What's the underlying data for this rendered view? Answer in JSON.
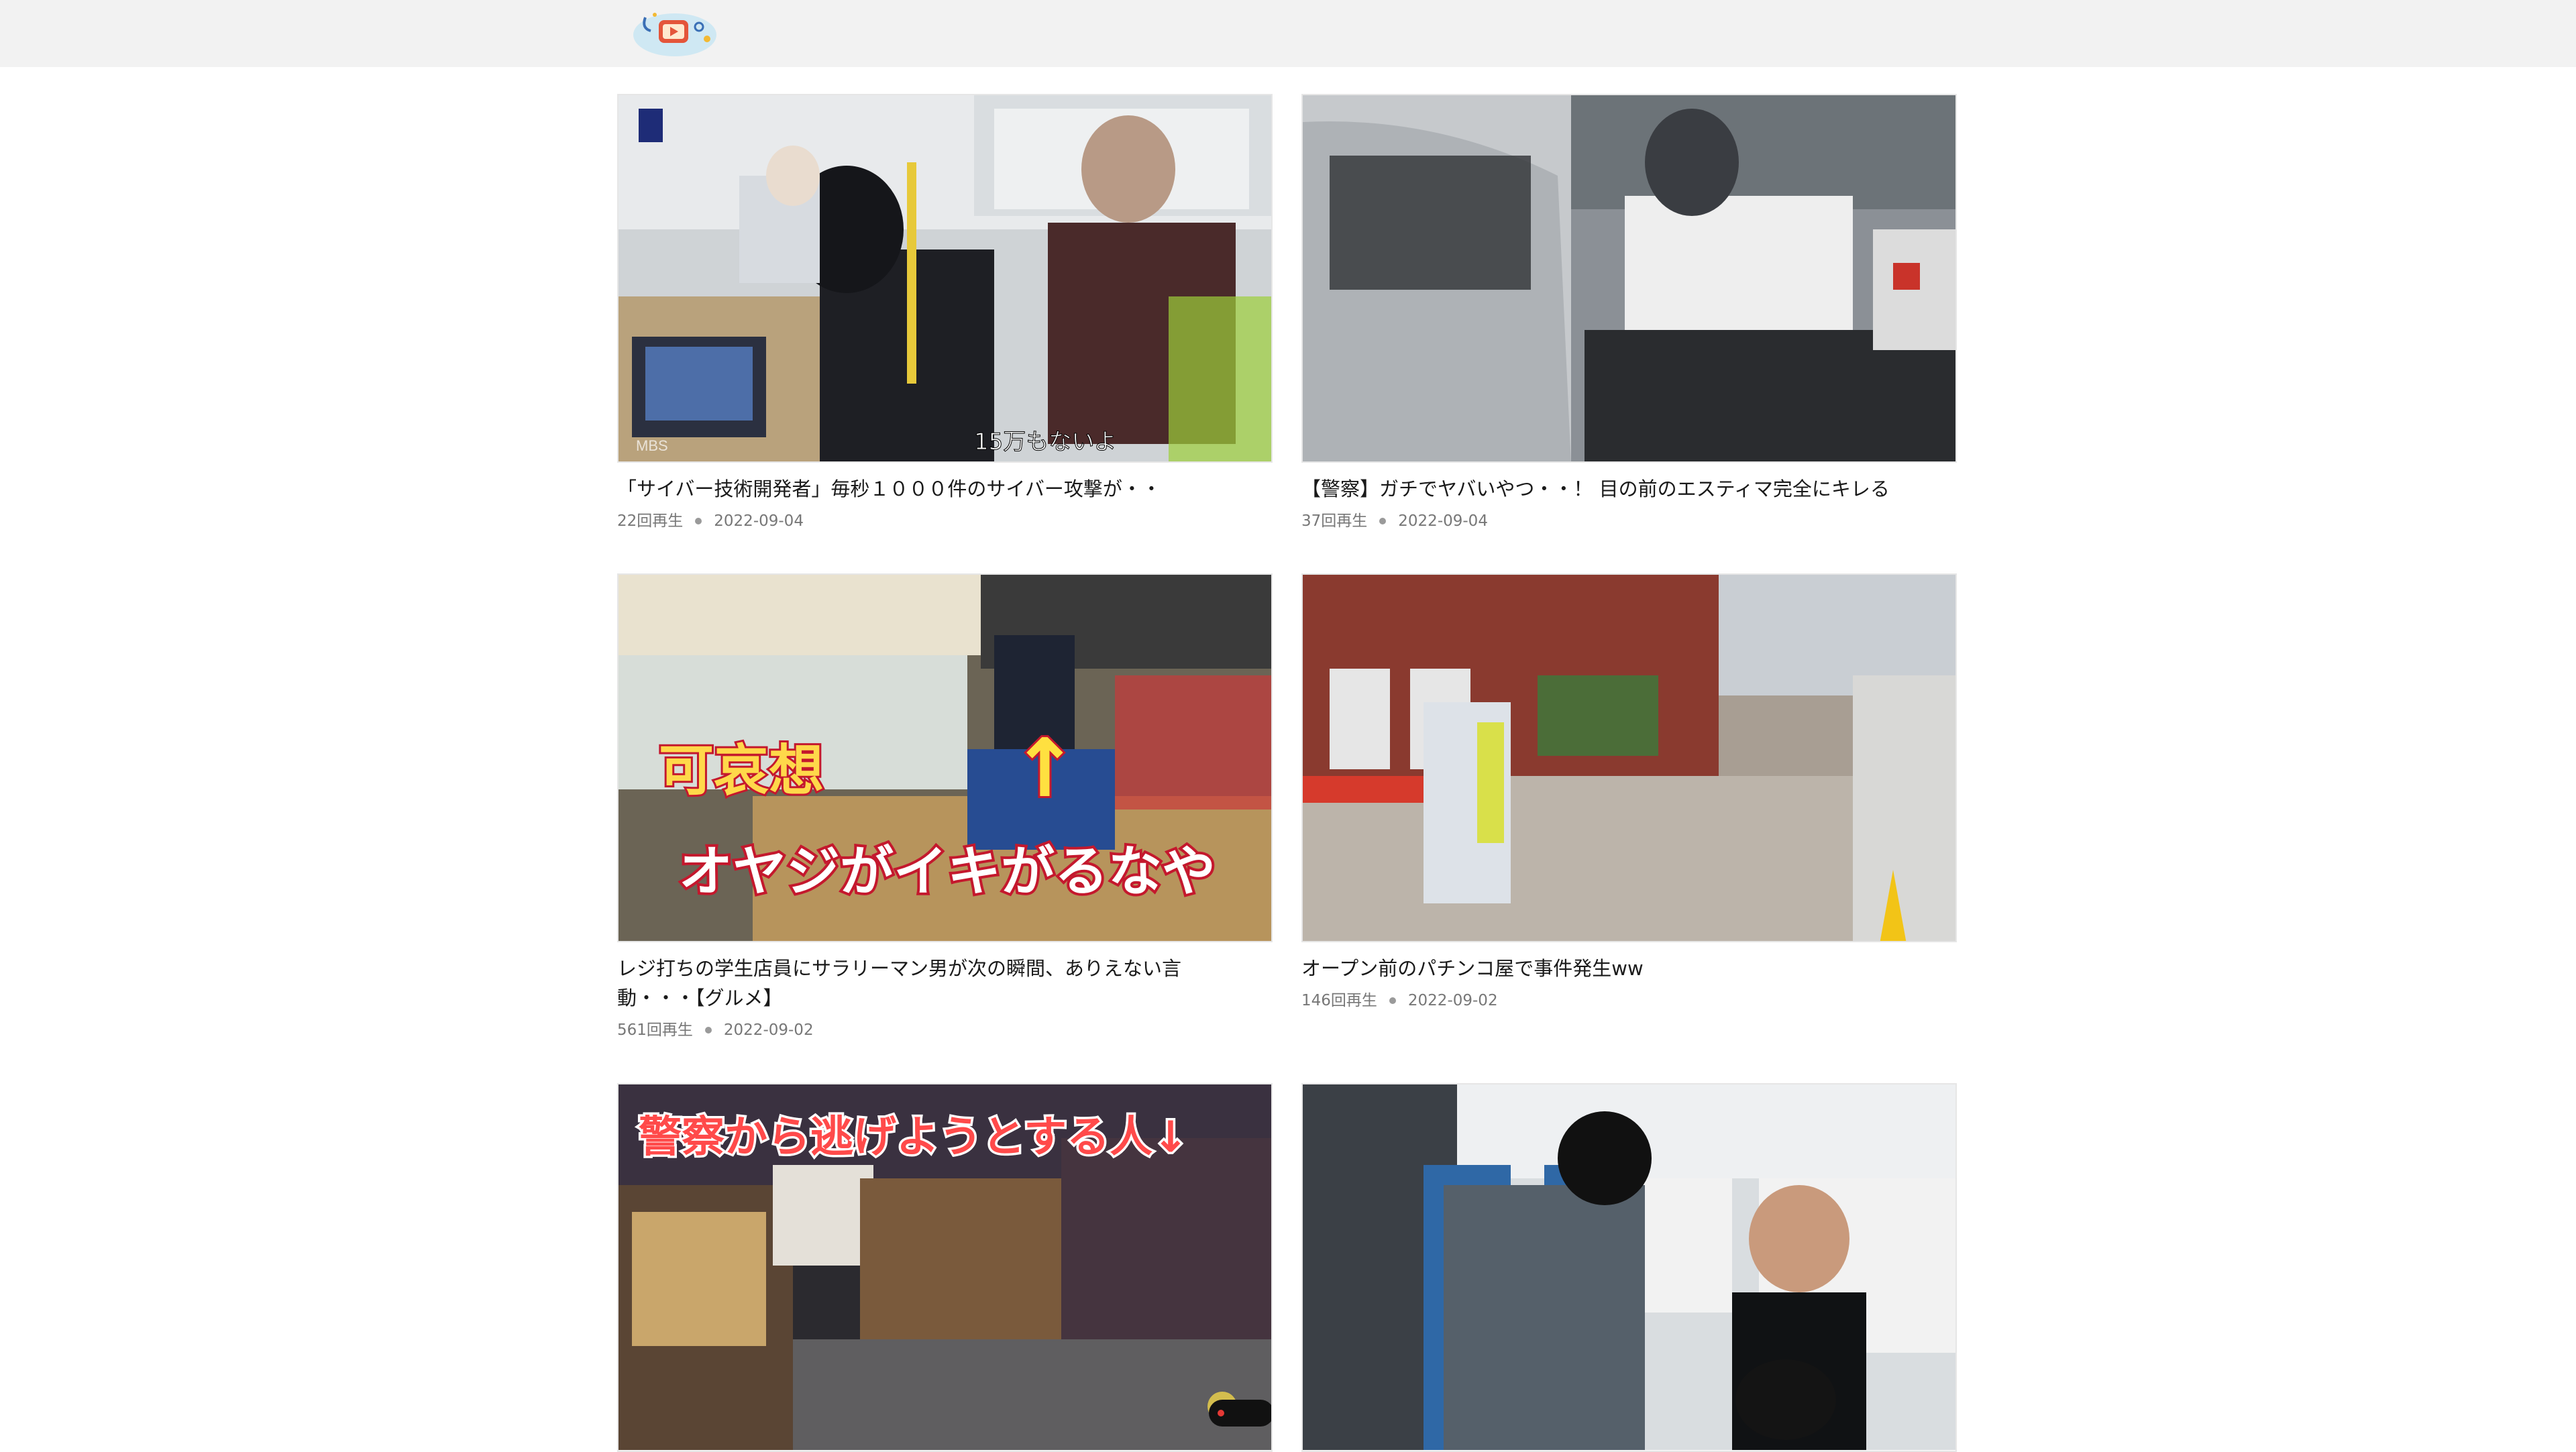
{
  "colors": {
    "header_bg": "#f2f2f2",
    "page_bg": "#ffffff",
    "meta_text": "#777777",
    "title_text": "#1a1a1a"
  },
  "header": {
    "logo_icon": "tv-play-logo-icon"
  },
  "videos": [
    {
      "title": "「サイバー技術開発者」毎秒１０００件のサイバー攻撃が・・",
      "views": "22回再生",
      "date": "2022-09-04",
      "overlay_text": "15万もないよ",
      "corner_logo": "MBS"
    },
    {
      "title": "【警察】ガチでヤバいやつ・・！ 目の前のエスティマ完全にキレる",
      "views": "37回再生",
      "date": "2022-09-04"
    },
    {
      "title": "レジ打ちの学生店員にサラリーマン男が次の瞬間、ありえない言動・・・【グルメ】",
      "views": "561回再生",
      "date": "2022-09-02",
      "overlay_text_1": "可哀想",
      "overlay_text_2": "オヤジがイキがるなや",
      "overlay_arrow": "↑"
    },
    {
      "title": "オープン前のパチンコ屋で事件発生ww",
      "views": "146回再生",
      "date": "2022-09-02"
    },
    {
      "title": "",
      "views": "",
      "date": "",
      "overlay_text": "警察から逃げようとする人↓"
    },
    {
      "title": "",
      "views": "",
      "date": ""
    }
  ]
}
